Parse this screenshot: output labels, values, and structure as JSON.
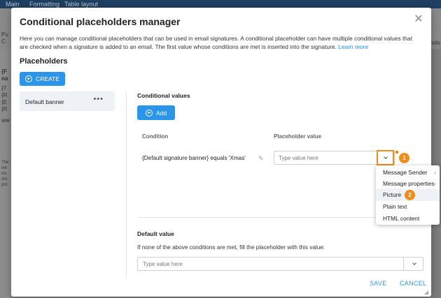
{
  "background": {
    "tabs": [
      "Main",
      "Formatting",
      "Table layout"
    ],
    "left_side_text": [
      "Pu",
      "C",
      "{F",
      "na",
      "{T",
      "{R",
      "{E",
      "{R",
      "ww",
      "The",
      "ine",
      "inc",
      "onl",
      "pro"
    ],
    "right_side_text": "holo"
  },
  "dialog": {
    "title": "Conditional placeholders manager",
    "close_icon": "close-icon",
    "description": "Here you can manage conditional placeholders that can be used in email signatures. A conditional placeholder can have multiple conditional values that are checked when a signature is added to an email. The first value whose conditions are met is inserted into the signature.",
    "learn_more": "Learn more",
    "section_title": "Placeholders",
    "create_button": "CREATE",
    "placeholders": [
      {
        "label": "Default banner",
        "more": "•••"
      }
    ],
    "conditional_values": {
      "title": "Conditional values",
      "add_button": "Add",
      "condition_header": "Condition",
      "value_header": "Placeholder value",
      "rows": [
        {
          "condition": "{Default signature banner} equals 'Xmas'",
          "value_placeholder": "Type value here"
        }
      ]
    },
    "default_value": {
      "title": "Default value",
      "description": "If none of the above conditions are met, fill the placeholder with this value:",
      "placeholder": "Type value here"
    },
    "save_button": "SAVE",
    "cancel_button": "CANCEL"
  },
  "dropdown_menu": {
    "items": [
      {
        "label": "Message Sender",
        "has_submenu": true
      },
      {
        "label": "Message properties",
        "has_submenu": true
      },
      {
        "label": "Picture",
        "has_submenu": false,
        "highlighted": true
      },
      {
        "label": "Plain text",
        "has_submenu": false
      },
      {
        "label": "HTML content",
        "has_submenu": false
      }
    ]
  },
  "markers": [
    "1",
    "2"
  ],
  "colors": {
    "accent": "#2b95ea",
    "highlight": "#f08c1a"
  }
}
